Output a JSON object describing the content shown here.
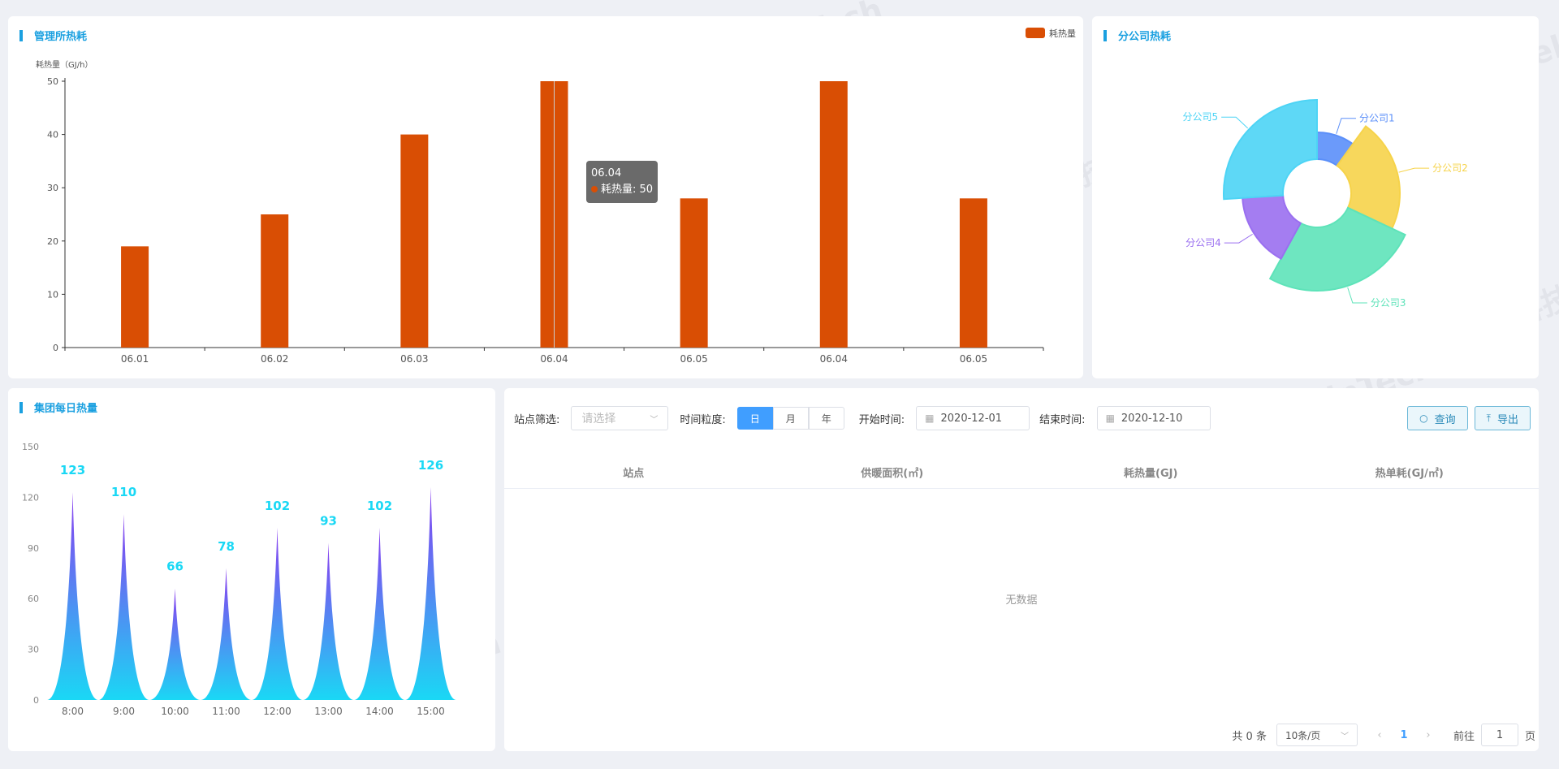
{
  "colors": {
    "bar": "#d94e04",
    "accent": "#1aa0e0",
    "primary": "#409eff"
  },
  "watermark": "亚控科技 WellinTech",
  "mgmt": {
    "title": "管理所热耗",
    "legend": "耗热量",
    "ylabel": "耗热量（GJ/h）",
    "tooltip": {
      "title": "06.04",
      "label": "耗热量: 50"
    }
  },
  "branch": {
    "title": "分公司热耗"
  },
  "daily": {
    "title": "集团每日热量"
  },
  "table": {
    "filter_label": "站点筛选:",
    "filter_placeholder": "请选择",
    "granularity_label": "时间粒度:",
    "granularity_options": [
      "日",
      "月",
      "年"
    ],
    "start_label": "开始时间:",
    "start_value": "2020-12-01",
    "end_label": "结束时间:",
    "end_value": "2020-12-10",
    "query_label": "查询",
    "export_label": "导出",
    "columns": [
      "站点",
      "供暖面积(㎡)",
      "耗热量(GJ)",
      "热单耗(GJ/㎡)"
    ],
    "empty_text": "无数据",
    "total_text": "共 0 条",
    "page_size": "10条/页",
    "current_page": "1",
    "goto_label": "前往",
    "goto_value": "1",
    "page_suffix": "页"
  },
  "chart_data": [
    {
      "type": "bar",
      "title": "管理所热耗",
      "categories": [
        "06.01",
        "06.02",
        "06.03",
        "06.04",
        "06.05",
        "06.04",
        "06.05"
      ],
      "series": [
        {
          "name": "耗热量",
          "values": [
            19,
            25,
            40,
            50,
            28,
            50,
            28
          ]
        }
      ],
      "ylabel": "耗热量（GJ/h）",
      "ylim": [
        0,
        50
      ],
      "yticks": [
        0,
        10,
        20,
        30,
        40,
        50
      ],
      "legend": "top-right"
    },
    {
      "type": "pie",
      "title": "分公司热耗",
      "slices": [
        {
          "name": "分公司1",
          "value": 10,
          "color": "#5b8ff9"
        },
        {
          "name": "分公司2",
          "value": 22,
          "color": "#f6d34a"
        },
        {
          "name": "分公司3",
          "value": 26,
          "color": "#5ee3b9"
        },
        {
          "name": "分公司4",
          "value": 16,
          "color": "#9a6ff0"
        },
        {
          "name": "分公司5",
          "value": 26,
          "color": "#4dd4f5"
        }
      ]
    },
    {
      "type": "area",
      "title": "集团每日热量",
      "categories": [
        "8:00",
        "9:00",
        "10:00",
        "11:00",
        "12:00",
        "13:00",
        "14:00",
        "15:00"
      ],
      "values": [
        123,
        110,
        66,
        78,
        102,
        93,
        102,
        126
      ],
      "ylim": [
        0,
        150
      ],
      "yticks": [
        0,
        30,
        60,
        90,
        120,
        150
      ]
    }
  ]
}
